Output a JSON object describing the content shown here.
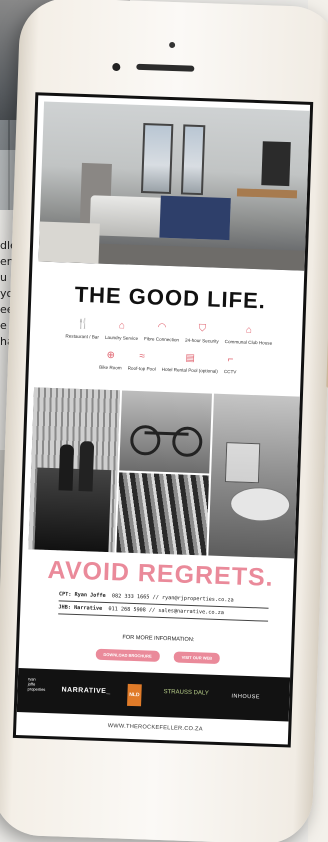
{
  "background_text": [
    "dle",
    "ent",
    "u r",
    "yo",
    "ee",
    "e di",
    "ha"
  ],
  "page": {
    "headline": "THE GOOD LIFE.",
    "amenities_row1": [
      {
        "icon": "fork-knife-icon",
        "glyph": "🍴",
        "label": "Restaurant / Bar"
      },
      {
        "icon": "hanger-icon",
        "glyph": "⌂",
        "label": "Laundry Service"
      },
      {
        "icon": "wifi-icon",
        "glyph": "◠",
        "label": "Fibre Connection"
      },
      {
        "icon": "shield-icon",
        "glyph": "⛉",
        "label": "24-hour Security"
      },
      {
        "icon": "house-icon",
        "glyph": "⌂",
        "label": "Communal Club House"
      }
    ],
    "amenities_row2": [
      {
        "icon": "bicycle-icon",
        "glyph": "⊕",
        "label": "Bike Room"
      },
      {
        "icon": "pool-icon",
        "glyph": "≈",
        "label": "Roof-top Pool"
      },
      {
        "icon": "building-icon",
        "glyph": "▤",
        "label": "Hotel Rental Pool (optional)"
      },
      {
        "icon": "cctv-icon",
        "glyph": "⌐",
        "label": "CCTV"
      }
    ],
    "tagline": "AVOID REGRETS.",
    "contacts": [
      {
        "region": "CPT: Ryan Joffe",
        "detail": "082 333 1665 // ryan@rjproperties.co.za"
      },
      {
        "region": "JHB: Narrative",
        "detail": "011 268 5908 // sales@narrative.co.za"
      }
    ],
    "more_info": "FOR MORE INFORMATION:",
    "buttons": {
      "brochure": "DOWNLOAD BROCHURE",
      "web": "VISIT OUR WEB"
    },
    "partners": {
      "rj": "ryan\njoffe\nproperties",
      "narrative": "NARRATIVE_",
      "nld": "NLD",
      "strauss": "STRAUSS DALY",
      "inhouse": "INHOUSE"
    },
    "url": "WWW.THEROCKEFELLER.CO.ZA"
  },
  "colors": {
    "accent": "#ea8a9a",
    "dark": "#121212",
    "orange": "#e07b29"
  }
}
